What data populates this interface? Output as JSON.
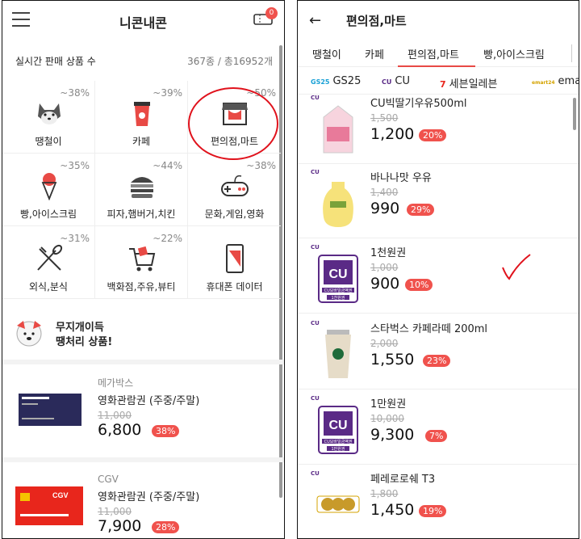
{
  "left": {
    "title": "니콘내콘",
    "badge_count": "0",
    "stats_label": "실시간 판매 상품 수",
    "stats_value": "367종 / 총16952개",
    "categories": [
      {
        "label": "땡철이",
        "pct": "~38%",
        "icon": "dog-icon"
      },
      {
        "label": "카페",
        "pct": "~39%",
        "icon": "coffee-cup-icon"
      },
      {
        "label": "편의점,마트",
        "pct": "~50%",
        "icon": "store-icon"
      },
      {
        "label": "빵,아이스크림",
        "pct": "~35%",
        "icon": "ice-cream-icon"
      },
      {
        "label": "피자,햄버거,치킨",
        "pct": "~44%",
        "icon": "burger-icon"
      },
      {
        "label": "문화,게임,영화",
        "pct": "~38%",
        "icon": "gamepad-icon"
      },
      {
        "label": "외식,분식",
        "pct": "~31%",
        "icon": "fork-spoon-icon"
      },
      {
        "label": "백화점,주유,뷰티",
        "pct": "~22%",
        "icon": "cart-icon"
      },
      {
        "label": "휴대폰 데이터",
        "pct": "",
        "icon": "phone-icon"
      }
    ],
    "promo_line1": "무지개이득",
    "promo_line2": "땡처리 상품!",
    "items": [
      {
        "brand": "메가박스",
        "name": "영화관람권 (주중/주말)",
        "old_price": "11,000",
        "price": "6,800",
        "discount": "38%"
      },
      {
        "brand": "CGV",
        "name": "영화관람권 (주중/주말)",
        "old_price": "11,000",
        "price": "7,900",
        "discount": "28%"
      }
    ]
  },
  "right": {
    "title": "편의점,마트",
    "tabs": [
      "땡철이",
      "카페",
      "편의점,마트",
      "빵,아이스크림"
    ],
    "active_tab": "편의점,마트",
    "brands": [
      {
        "logo": "GS25",
        "label": "GS25"
      },
      {
        "logo": "CU",
        "label": "CU"
      },
      {
        "logo": "7",
        "label": "세븐일레븐"
      },
      {
        "logo": "emart24",
        "label": "ema"
      }
    ],
    "brand_logo": "CU",
    "products": [
      {
        "name": "CU빅딸기우유500ml",
        "old_price": "1,500",
        "price": "1,200",
        "discount": "20%",
        "thumb": "strawberry-milk"
      },
      {
        "name": "바나나맛 우유",
        "old_price": "1,400",
        "price": "990",
        "discount": "29%",
        "thumb": "banana-milk"
      },
      {
        "name": "1천원권",
        "old_price": "1,000",
        "price": "900",
        "discount": "10%",
        "thumb": "cu-voucher",
        "voucher": "1천원권"
      },
      {
        "name": "스타벅스 카페라떼 200ml",
        "old_price": "2,000",
        "price": "1,550",
        "discount": "23%",
        "thumb": "starbucks-latte"
      },
      {
        "name": "1만원권",
        "old_price": "10,000",
        "price": "9,300",
        "discount": "7%",
        "thumb": "cu-voucher",
        "voucher": "1만원권"
      },
      {
        "name": "페레로로쉐 T3",
        "old_price": "1,800",
        "price": "1,450",
        "discount": "19%",
        "thumb": "ferrero-rocher"
      }
    ],
    "voucher_caption": "CU모바일금액권"
  },
  "colors": {
    "accent": "#f0524d",
    "annotation": "#e0121c",
    "cu_purple": "#5a2a86"
  }
}
